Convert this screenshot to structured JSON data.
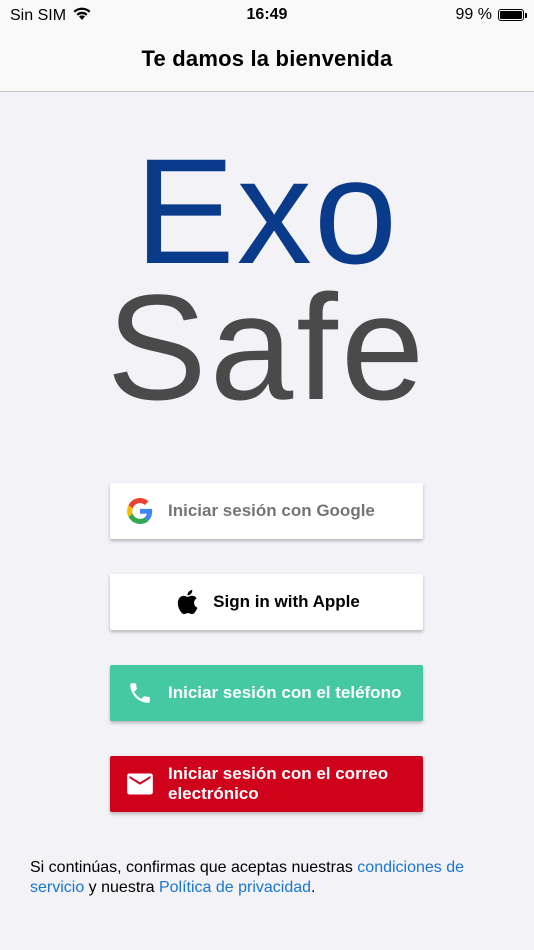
{
  "status_bar": {
    "carrier": "Sin SIM",
    "time": "16:49",
    "battery_percent_text": "99 %",
    "battery_level": 0.99
  },
  "nav": {
    "title": "Te damos la bienvenida"
  },
  "logo": {
    "line1": "Exo",
    "line2": "Safe",
    "line1_color": "#0a3a8a",
    "line2_color": "#4a4a4a"
  },
  "buttons": {
    "google": {
      "label": "Iniciar sesión con Google",
      "icon": "google-icon"
    },
    "apple": {
      "label": "Sign in with Apple",
      "icon": "apple-icon"
    },
    "phone": {
      "label": "Iniciar sesión con el teléfono",
      "icon": "phone-icon",
      "color": "#45c9a4"
    },
    "email": {
      "label": "Iniciar sesión con el correo electrónico",
      "icon": "mail-icon",
      "color": "#d0021b"
    }
  },
  "footer": {
    "text_before": "Si continúas, confirmas que aceptas nuestras ",
    "terms_link": "condiciones de servicio",
    "text_middle": " y nuestra ",
    "privacy_link": "Política de privacidad",
    "text_after": ".",
    "link_color": "#1976d2"
  }
}
